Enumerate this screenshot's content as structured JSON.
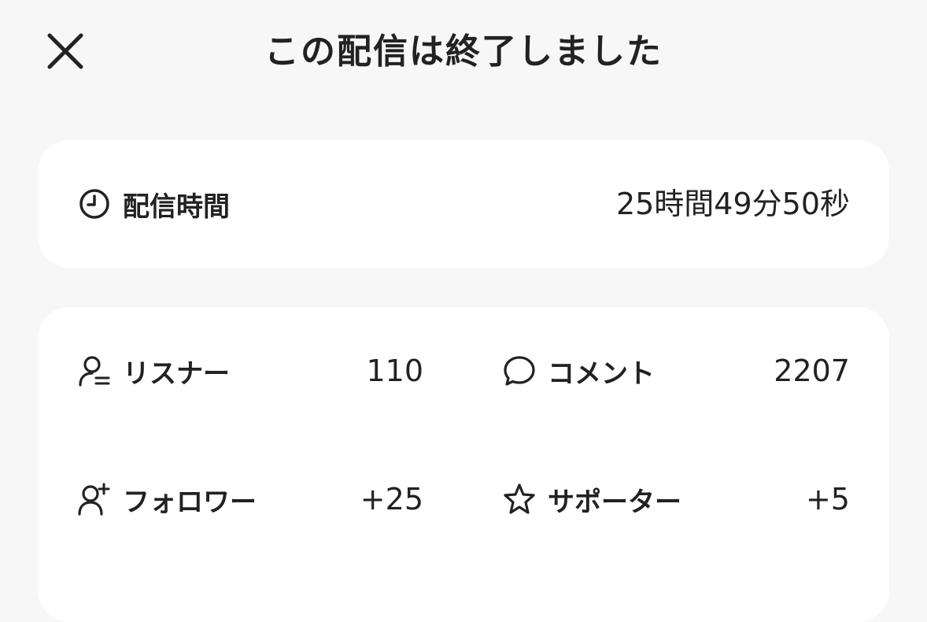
{
  "header": {
    "title": "この配信は終了しました",
    "close_icon": "close-icon"
  },
  "duration": {
    "icon": "clock-icon",
    "label": "配信時間",
    "value": "25時間49分50秒"
  },
  "stats": [
    {
      "icon": "listener-icon",
      "label": "リスナー",
      "value": "110"
    },
    {
      "icon": "comment-icon",
      "label": "コメント",
      "value": "2207"
    },
    {
      "icon": "add-follower-icon",
      "label": "フォロワー",
      "value": "+25"
    },
    {
      "icon": "star-icon",
      "label": "サポーター",
      "value": "+5"
    }
  ]
}
